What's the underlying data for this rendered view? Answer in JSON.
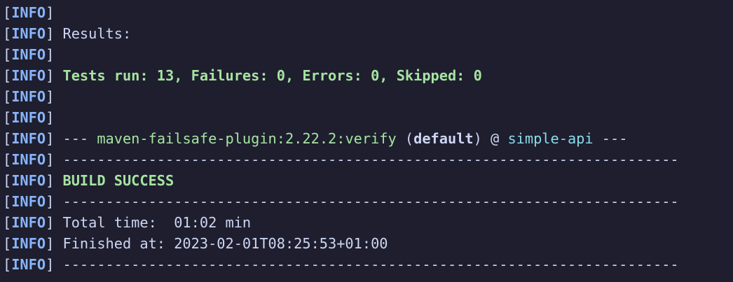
{
  "terminal": {
    "colors": {
      "background": "#1e1e2e",
      "text": "#cdd6f4",
      "info_tag": "#89b4fa",
      "success": "#a6e3a1",
      "project": "#89dceb"
    },
    "prefix": {
      "open": "[",
      "tag": "INFO",
      "close": "]"
    },
    "lines": [
      {
        "text": ""
      },
      {
        "text": " Results:"
      },
      {
        "text": ""
      },
      {
        "text": " Tests run: 13, Failures: 0, Errors: 0, Skipped: 0"
      },
      {
        "text": ""
      },
      {
        "text": ""
      },
      {
        "pre": " --- ",
        "plugin": "maven-failsafe-plugin:2.22.2:verify",
        "mid_open": " (",
        "execution": "default",
        "mid_close": ") @ ",
        "project": "simple-api",
        "post": " ---"
      },
      {
        "text": " ------------------------------------------------------------------------"
      },
      {
        "text": " BUILD SUCCESS"
      },
      {
        "text": " ------------------------------------------------------------------------"
      },
      {
        "text": " Total time:  01:02 min"
      },
      {
        "text": " Finished at: 2023-02-01T08:25:53+01:00"
      },
      {
        "text": " ------------------------------------------------------------------------"
      }
    ]
  }
}
